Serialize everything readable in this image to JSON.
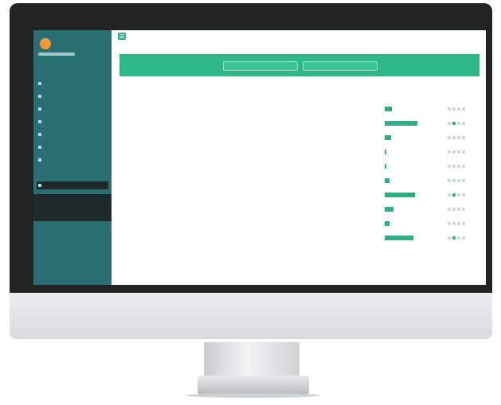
{
  "colors": {
    "bezel": "#222423",
    "sidebar": "#2a6f72",
    "accent": "#2fb787",
    "avatar": "#f29a3a"
  },
  "app": {
    "brand": "",
    "user_menu": ""
  },
  "sidebar": {
    "items": [
      {
        "label": "",
        "icon": "dashboard-icon",
        "active": false
      },
      {
        "label": "",
        "icon": "folder-icon",
        "active": false
      },
      {
        "label": "",
        "icon": "calendar-icon",
        "active": false
      },
      {
        "label": "",
        "icon": "chart-icon",
        "active": false
      },
      {
        "label": "",
        "icon": "user-icon",
        "active": false
      },
      {
        "label": "",
        "icon": "settings-icon",
        "active": false
      },
      {
        "label": "",
        "icon": "list-icon",
        "active": false
      },
      {
        "label": "",
        "icon": "grid-icon",
        "active": true
      },
      {
        "label": "",
        "icon": "sub-item-icon",
        "active": false,
        "sub": true
      },
      {
        "label": "",
        "icon": "sub-item-icon",
        "active": false,
        "sub": true
      }
    ]
  },
  "banner": {
    "button_a": "",
    "button_b": ""
  },
  "table": {
    "headers": [
      "",
      "",
      "",
      "",
      ""
    ],
    "rows": [
      {
        "name": "",
        "type": "",
        "date": "",
        "progress": 0.18
      },
      {
        "name": "",
        "type": "",
        "date": "",
        "progress": 0.78
      },
      {
        "name": "",
        "type": "",
        "date": "",
        "progress": 0.16
      },
      {
        "name": "",
        "type": "",
        "date": "",
        "progress": 0.04
      },
      {
        "name": "",
        "type": "",
        "date": "",
        "progress": 0.04
      },
      {
        "name": "",
        "type": "",
        "date": "",
        "progress": 0.12
      },
      {
        "name": "",
        "type": "",
        "date": "",
        "progress": 0.74
      },
      {
        "name": "",
        "type": "",
        "date": "",
        "progress": 0.22
      },
      {
        "name": "",
        "type": "",
        "date": "",
        "progress": 0.12
      },
      {
        "name": "",
        "type": "",
        "date": "",
        "progress": 0.7
      }
    ]
  }
}
